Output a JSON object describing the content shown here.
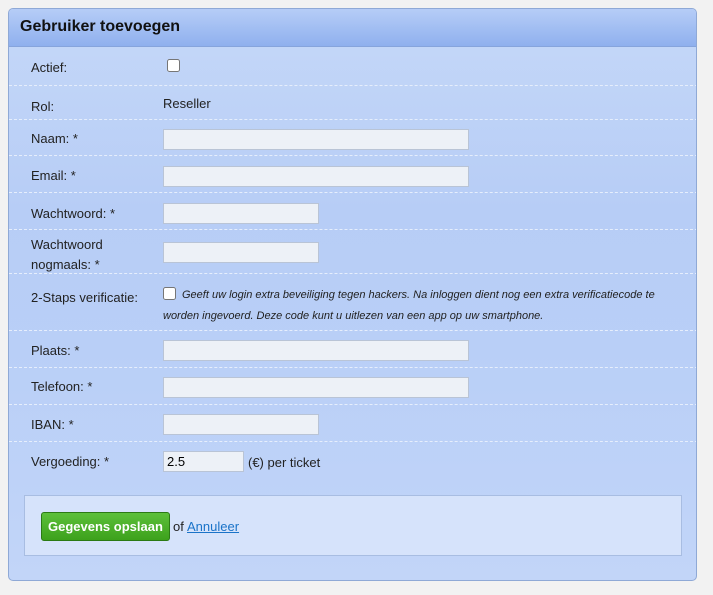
{
  "form": {
    "title": "Gebruiker toevoegen",
    "fields": {
      "actief": {
        "label": "Actief:",
        "checked": false
      },
      "rol": {
        "label": "Rol:",
        "value": "Reseller"
      },
      "naam": {
        "label": "Naam: *",
        "value": ""
      },
      "email": {
        "label": "Email: *",
        "value": ""
      },
      "wachtwoord": {
        "label": "Wachtwoord: *",
        "value": ""
      },
      "wachtwoord_nogmaals": {
        "label_line1": "Wachtwoord",
        "label_line2": "nogmaals: *",
        "value": ""
      },
      "twostep": {
        "label": "2-Staps verificatie:",
        "checked": false,
        "help": "Geeft uw login extra beveiliging tegen hackers. Na inloggen dient nog een extra verificatiecode te worden ingevoerd. Deze code kunt u uitlezen van een app op uw smartphone."
      },
      "plaats": {
        "label": "Plaats: *",
        "value": ""
      },
      "telefoon": {
        "label": "Telefoon: *",
        "value": ""
      },
      "iban": {
        "label": "IBAN: *",
        "value": ""
      },
      "vergoeding": {
        "label": "Vergoeding: *",
        "value": "2.5",
        "suffix": "(€) per ticket"
      }
    },
    "actions": {
      "save_label": "Gegevens opslaan",
      "or_text": "of",
      "cancel_label": "Annuleer"
    }
  },
  "colors": {
    "panel_bg": "#b9cff7",
    "header_bg": "#8fb0ee",
    "save_button": "#3da11c",
    "link": "#1a73c8"
  }
}
